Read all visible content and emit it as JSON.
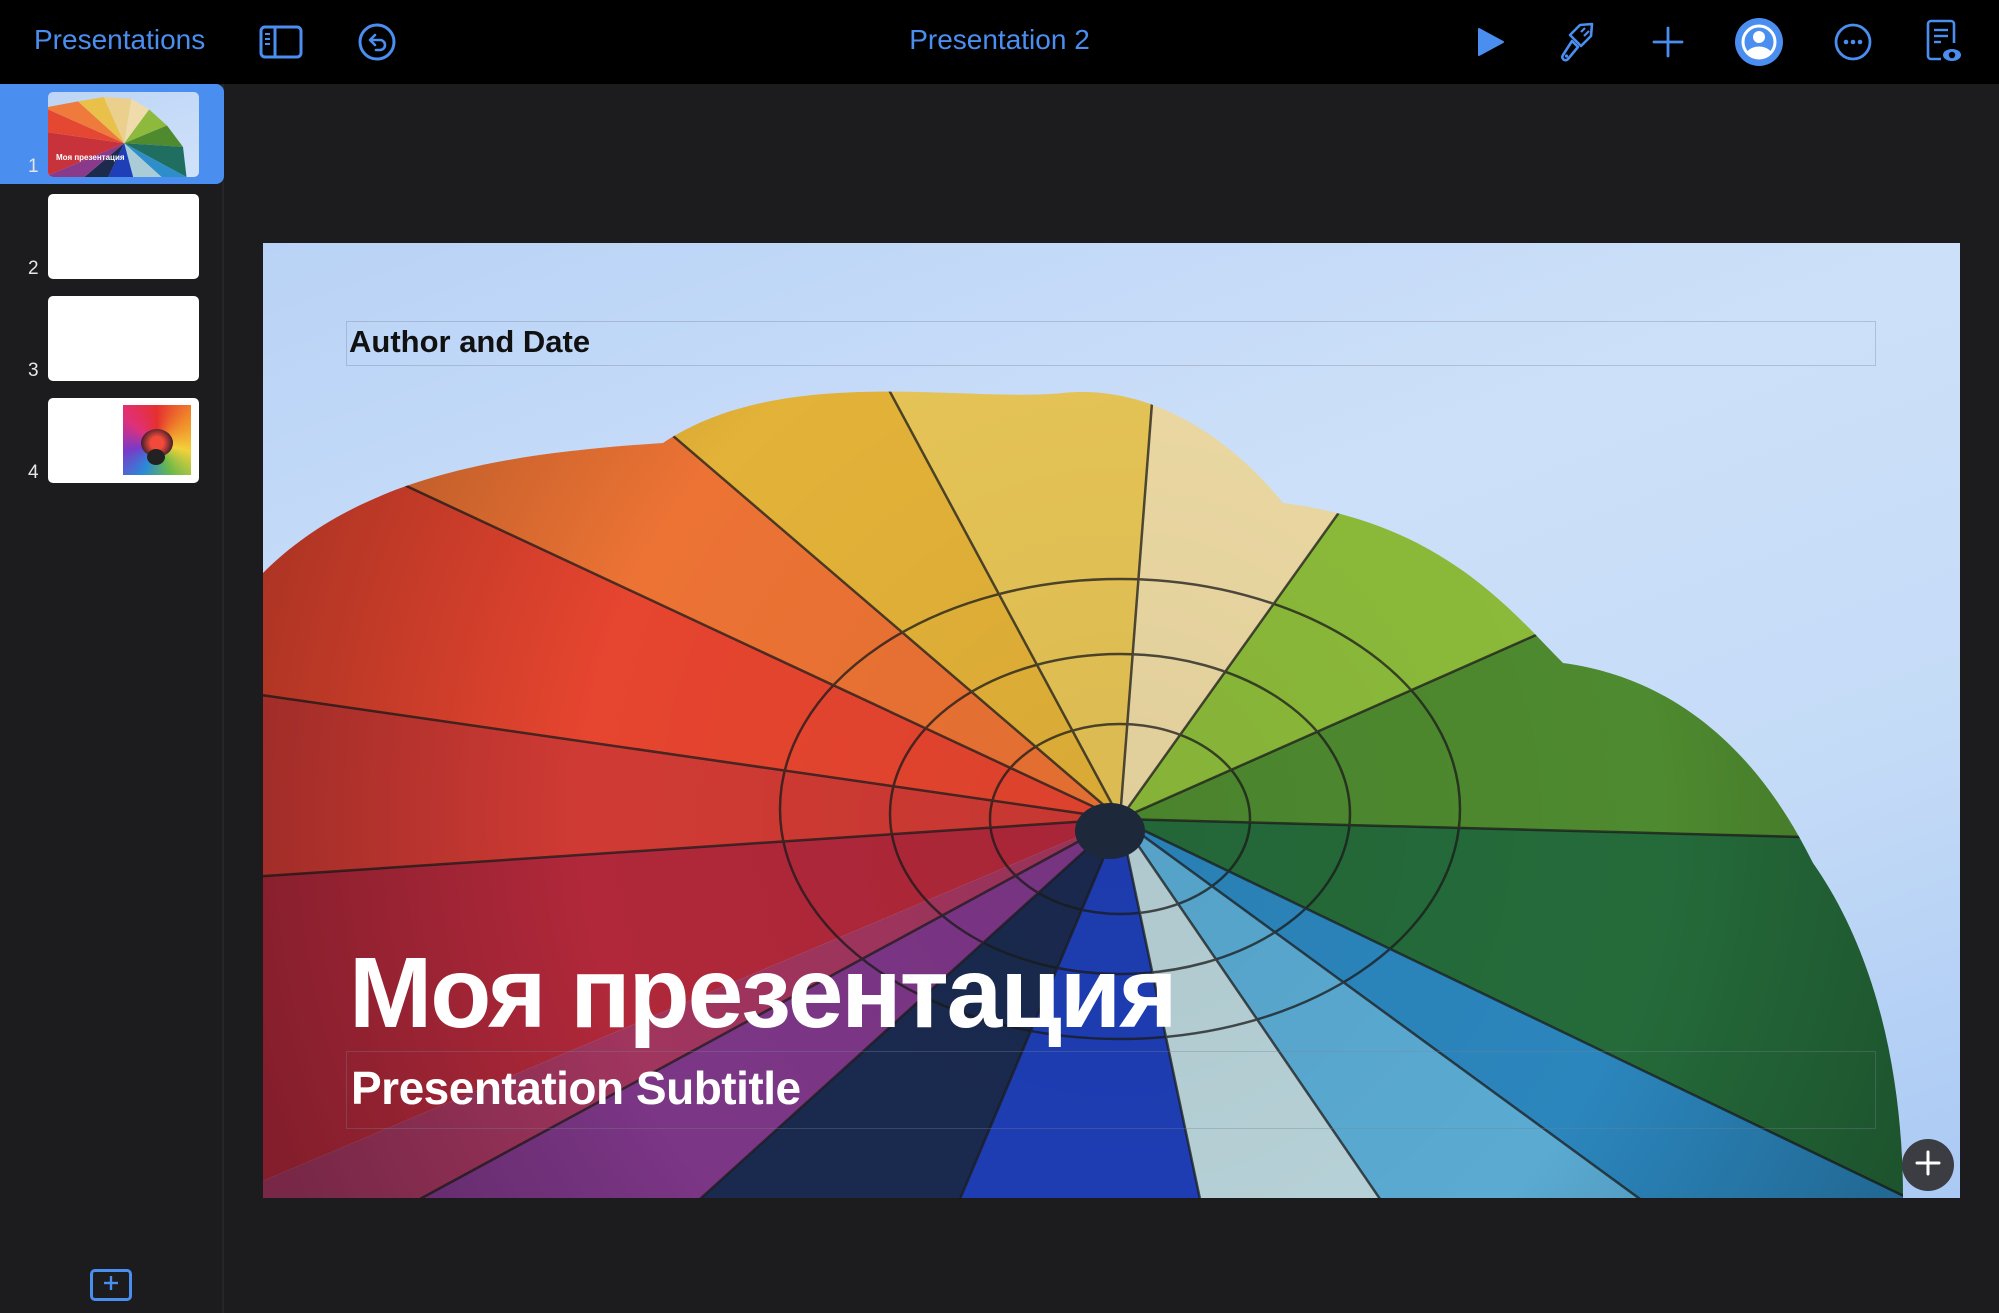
{
  "toolbar": {
    "back_label": "Presentations",
    "title": "Presentation 2",
    "icons": {
      "sidebar_toggle": "sidebar-toggle-icon",
      "undo": "undo-icon",
      "play": "play-icon",
      "format": "paintbrush-icon",
      "insert": "plus-icon",
      "collaborate": "person-circle-icon",
      "more": "ellipsis-circle-icon",
      "presenter_notes": "document-eye-icon"
    },
    "accent_color": "#4a8ef0"
  },
  "sidebar": {
    "slides": [
      {
        "number": "1",
        "selected": true,
        "thumbnail_title": "Моя презентация",
        "kind": "title-balloon"
      },
      {
        "number": "2",
        "selected": false,
        "kind": "blank"
      },
      {
        "number": "3",
        "selected": false,
        "kind": "blank"
      },
      {
        "number": "4",
        "selected": false,
        "kind": "image-right"
      }
    ],
    "add_slide_icon": "add-slide-icon"
  },
  "slide": {
    "author_placeholder": "Author and Date",
    "title": "Моя презентация",
    "subtitle": "Presentation Subtitle",
    "add_button_icon": "plus-icon"
  }
}
